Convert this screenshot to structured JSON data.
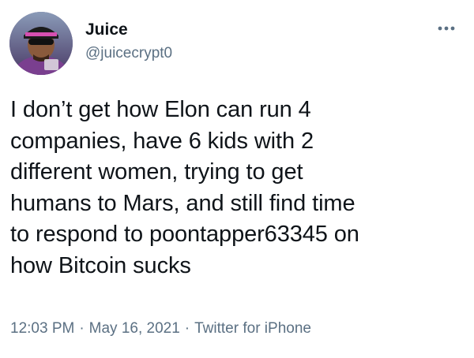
{
  "tweet": {
    "display_name": "Juice",
    "handle": "@juicecrypt0",
    "text": "I don’t get how Elon can run 4\ncompanies, have 6 kids with 2\ndifferent women, trying to get\nhumans to Mars, and still find time\nto respond to poontapper63345 on\nhow Bitcoin sucks",
    "time": "12:03 PM",
    "date": "May 16, 2021",
    "source": "Twitter for iPhone",
    "separator": "·",
    "more_icon": "more-horizontal-icon",
    "avatar_icon": "profile-photo"
  },
  "colors": {
    "text_primary": "#0f1419",
    "text_secondary": "#5b7083",
    "background": "#ffffff"
  }
}
